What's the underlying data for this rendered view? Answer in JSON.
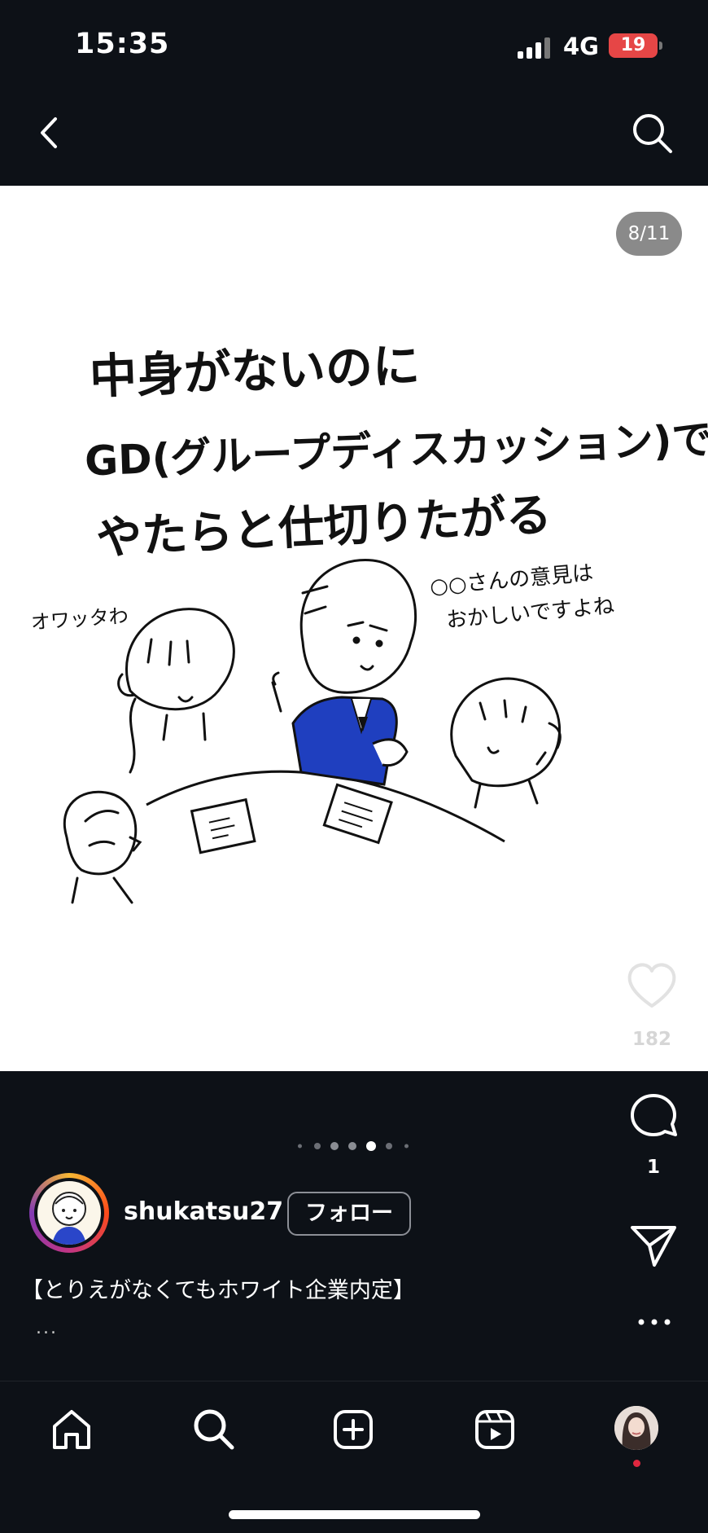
{
  "status_bar": {
    "time": "15:35",
    "network": "4G",
    "battery": "19"
  },
  "post": {
    "page_indicator": "8/11",
    "image_text": {
      "line1": "中身がないのに",
      "line2": "GD(グループディスカッション)で",
      "line3": "やたらと仕切りたがる",
      "bubble_left": "オワッタわ",
      "bubble_right_1": "○○さんの意見は",
      "bubble_right_2": "おかしいですよね"
    },
    "like_count": "182",
    "comment_count": "1"
  },
  "author": {
    "username": "shukatsu27",
    "follow_label": "フォロー"
  },
  "caption": {
    "text": "【とりえがなくてもホワイト企業内定】",
    "more": "..."
  },
  "colors": {
    "background": "#0d1117",
    "accent_red": "#e64646",
    "ink_blue": "#1f3fbf"
  },
  "icons": {
    "back": "chevron-left-icon",
    "search": "search-icon",
    "like": "heart-icon",
    "comment": "comment-bubble-icon",
    "share": "paper-plane-icon",
    "more": "ellipsis-icon",
    "home": "home-icon",
    "explore": "search-icon",
    "create": "plus-square-icon",
    "reels": "reels-icon"
  }
}
